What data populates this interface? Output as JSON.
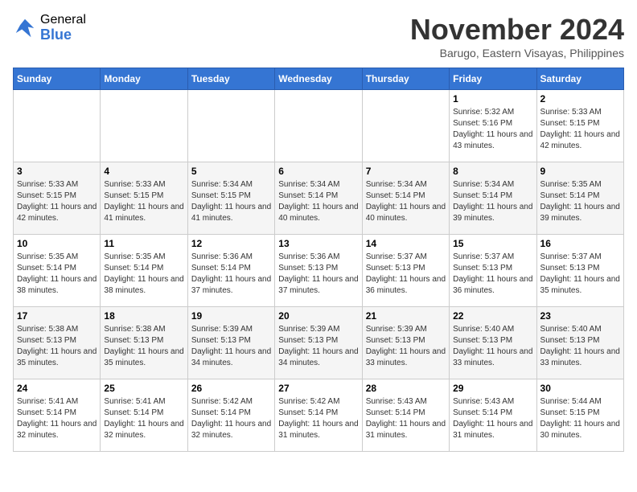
{
  "logo": {
    "general": "General",
    "blue": "Blue"
  },
  "title": {
    "month": "November 2024",
    "location": "Barugo, Eastern Visayas, Philippines"
  },
  "weekdays": [
    "Sunday",
    "Monday",
    "Tuesday",
    "Wednesday",
    "Thursday",
    "Friday",
    "Saturday"
  ],
  "weeks": [
    [
      {
        "day": "",
        "info": ""
      },
      {
        "day": "",
        "info": ""
      },
      {
        "day": "",
        "info": ""
      },
      {
        "day": "",
        "info": ""
      },
      {
        "day": "",
        "info": ""
      },
      {
        "day": "1",
        "info": "Sunrise: 5:32 AM\nSunset: 5:16 PM\nDaylight: 11 hours and 43 minutes."
      },
      {
        "day": "2",
        "info": "Sunrise: 5:33 AM\nSunset: 5:15 PM\nDaylight: 11 hours and 42 minutes."
      }
    ],
    [
      {
        "day": "3",
        "info": "Sunrise: 5:33 AM\nSunset: 5:15 PM\nDaylight: 11 hours and 42 minutes."
      },
      {
        "day": "4",
        "info": "Sunrise: 5:33 AM\nSunset: 5:15 PM\nDaylight: 11 hours and 41 minutes."
      },
      {
        "day": "5",
        "info": "Sunrise: 5:34 AM\nSunset: 5:15 PM\nDaylight: 11 hours and 41 minutes."
      },
      {
        "day": "6",
        "info": "Sunrise: 5:34 AM\nSunset: 5:14 PM\nDaylight: 11 hours and 40 minutes."
      },
      {
        "day": "7",
        "info": "Sunrise: 5:34 AM\nSunset: 5:14 PM\nDaylight: 11 hours and 40 minutes."
      },
      {
        "day": "8",
        "info": "Sunrise: 5:34 AM\nSunset: 5:14 PM\nDaylight: 11 hours and 39 minutes."
      },
      {
        "day": "9",
        "info": "Sunrise: 5:35 AM\nSunset: 5:14 PM\nDaylight: 11 hours and 39 minutes."
      }
    ],
    [
      {
        "day": "10",
        "info": "Sunrise: 5:35 AM\nSunset: 5:14 PM\nDaylight: 11 hours and 38 minutes."
      },
      {
        "day": "11",
        "info": "Sunrise: 5:35 AM\nSunset: 5:14 PM\nDaylight: 11 hours and 38 minutes."
      },
      {
        "day": "12",
        "info": "Sunrise: 5:36 AM\nSunset: 5:14 PM\nDaylight: 11 hours and 37 minutes."
      },
      {
        "day": "13",
        "info": "Sunrise: 5:36 AM\nSunset: 5:13 PM\nDaylight: 11 hours and 37 minutes."
      },
      {
        "day": "14",
        "info": "Sunrise: 5:37 AM\nSunset: 5:13 PM\nDaylight: 11 hours and 36 minutes."
      },
      {
        "day": "15",
        "info": "Sunrise: 5:37 AM\nSunset: 5:13 PM\nDaylight: 11 hours and 36 minutes."
      },
      {
        "day": "16",
        "info": "Sunrise: 5:37 AM\nSunset: 5:13 PM\nDaylight: 11 hours and 35 minutes."
      }
    ],
    [
      {
        "day": "17",
        "info": "Sunrise: 5:38 AM\nSunset: 5:13 PM\nDaylight: 11 hours and 35 minutes."
      },
      {
        "day": "18",
        "info": "Sunrise: 5:38 AM\nSunset: 5:13 PM\nDaylight: 11 hours and 35 minutes."
      },
      {
        "day": "19",
        "info": "Sunrise: 5:39 AM\nSunset: 5:13 PM\nDaylight: 11 hours and 34 minutes."
      },
      {
        "day": "20",
        "info": "Sunrise: 5:39 AM\nSunset: 5:13 PM\nDaylight: 11 hours and 34 minutes."
      },
      {
        "day": "21",
        "info": "Sunrise: 5:39 AM\nSunset: 5:13 PM\nDaylight: 11 hours and 33 minutes."
      },
      {
        "day": "22",
        "info": "Sunrise: 5:40 AM\nSunset: 5:13 PM\nDaylight: 11 hours and 33 minutes."
      },
      {
        "day": "23",
        "info": "Sunrise: 5:40 AM\nSunset: 5:13 PM\nDaylight: 11 hours and 33 minutes."
      }
    ],
    [
      {
        "day": "24",
        "info": "Sunrise: 5:41 AM\nSunset: 5:14 PM\nDaylight: 11 hours and 32 minutes."
      },
      {
        "day": "25",
        "info": "Sunrise: 5:41 AM\nSunset: 5:14 PM\nDaylight: 11 hours and 32 minutes."
      },
      {
        "day": "26",
        "info": "Sunrise: 5:42 AM\nSunset: 5:14 PM\nDaylight: 11 hours and 32 minutes."
      },
      {
        "day": "27",
        "info": "Sunrise: 5:42 AM\nSunset: 5:14 PM\nDaylight: 11 hours and 31 minutes."
      },
      {
        "day": "28",
        "info": "Sunrise: 5:43 AM\nSunset: 5:14 PM\nDaylight: 11 hours and 31 minutes."
      },
      {
        "day": "29",
        "info": "Sunrise: 5:43 AM\nSunset: 5:14 PM\nDaylight: 11 hours and 31 minutes."
      },
      {
        "day": "30",
        "info": "Sunrise: 5:44 AM\nSunset: 5:15 PM\nDaylight: 11 hours and 30 minutes."
      }
    ]
  ]
}
